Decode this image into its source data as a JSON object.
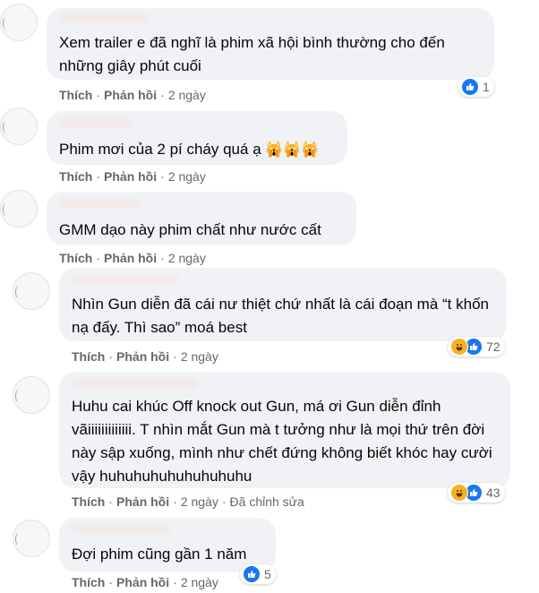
{
  "comments": [
    {
      "text": "Xem trailer e đã nghĩ là phim xã hội bình thường cho đến những giây phút cuối",
      "like": "Thích",
      "reply": "Phản hồi",
      "time": "2 ngày",
      "reactions": [
        "like"
      ],
      "reaction_count": "1"
    },
    {
      "text": "Phim mơi của 2 pí cháy quá ạ",
      "emoji": "🙀🙀🙀",
      "like": "Thích",
      "reply": "Phản hồi",
      "time": "2 ngày"
    },
    {
      "text": "GMM dạo này phim chất như nước cất",
      "like": "Thích",
      "reply": "Phản hồi",
      "time": "2 ngày"
    },
    {
      "text": "Nhìn Gun diễn đã cái nư thiệt chứ nhất là cái đoạn mà “t khốn nạ đấy. Thì sao” moá best",
      "like": "Thích",
      "reply": "Phản hồi",
      "time": "2 ngày",
      "reactions": [
        "haha",
        "like"
      ],
      "reaction_count": "72"
    },
    {
      "text": "Huhu cai khúc Off knock out Gun, má ơi Gun diễn đỉnh vãiiiiiiiiiiiii. T nhìn mắt Gun mà t tưởng như là mọi thứ trên đời này sập xuống, mình như chết đứng không biết khóc hay cười vậy huhuhuhuhuhuhuhuhu",
      "like": "Thích",
      "reply": "Phản hồi",
      "time": "2 ngày",
      "edited": "Đã chỉnh sửa",
      "reactions": [
        "haha",
        "like"
      ],
      "reaction_count": "43"
    },
    {
      "text": "Đợi phim cũng gần 1 năm",
      "like": "Thích",
      "reply": "Phản hồi",
      "time": "2 ngày",
      "reactions": [
        "like"
      ],
      "reaction_count": "5"
    }
  ],
  "colors": {
    "bubble": "#f0f2f5",
    "text": "#050505",
    "meta": "#65676b",
    "like_blue": "#1877f2",
    "haha_yellow": "#f7b125"
  },
  "icons": [
    "like-icon",
    "haha-icon",
    "avatar"
  ]
}
